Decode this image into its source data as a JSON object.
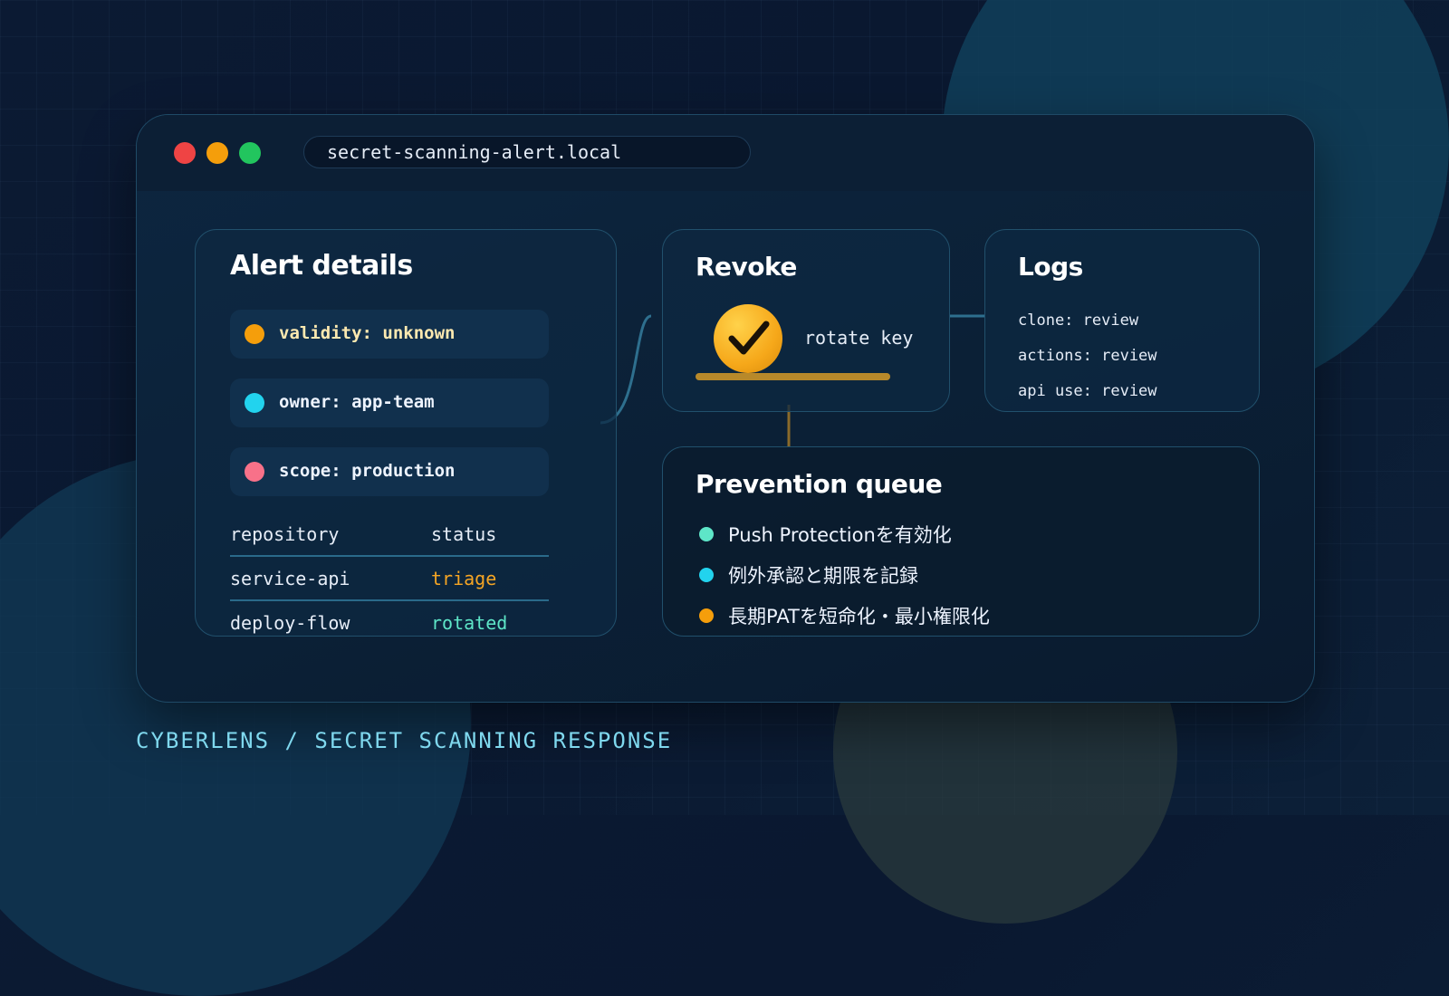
{
  "window": {
    "url": "secret-scanning-alert.local"
  },
  "alert_details": {
    "title": "Alert details",
    "pills": [
      {
        "text": "validity: unknown",
        "color": "#f59e0b"
      },
      {
        "text": "owner: app-team",
        "color": "#22d3ee"
      },
      {
        "text": "scope: production",
        "color": "#f87189"
      }
    ],
    "table": {
      "headers": [
        "repository",
        "status"
      ],
      "rows": [
        {
          "repository": "service-api",
          "status": "triage",
          "status_color": "#f5a524"
        },
        {
          "repository": "deploy-flow",
          "status": "rotated",
          "status_color": "#5ee6c8"
        }
      ]
    }
  },
  "revoke": {
    "title": "Revoke",
    "action_label": "rotate key",
    "icon": "check-icon",
    "progress": 1.0
  },
  "logs": {
    "title": "Logs",
    "lines": [
      "clone: review",
      "actions: review",
      "api use: review"
    ]
  },
  "prevention": {
    "title": "Prevention queue",
    "items": [
      {
        "text": "Push Protectionを有効化",
        "color": "#5ee6c8"
      },
      {
        "text": "例外承認と期限を記録",
        "color": "#22d3ee"
      },
      {
        "text": "長期PATを短命化・最小権限化",
        "color": "#f59e0b"
      }
    ]
  },
  "footer": {
    "text": "CYBERLENS / SECRET SCANNING RESPONSE"
  },
  "colors": {
    "accent_gold": "#f6a81a",
    "accent_teal": "#7fd8ee",
    "window_bg": "#0b2036"
  }
}
